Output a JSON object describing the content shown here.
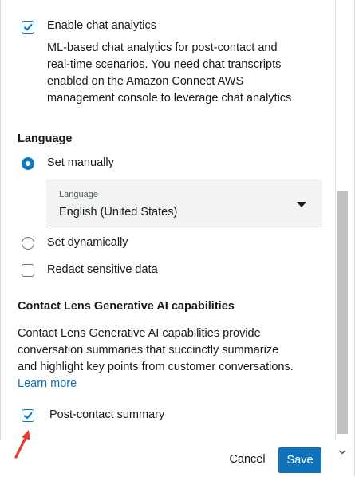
{
  "chat_analytics": {
    "label": "Enable chat analytics",
    "checked": true,
    "description_lines": [
      "ML-based chat analytics for post-contact and",
      "real-time scenarios. You need chat transcripts",
      "enabled on the Amazon Connect AWS",
      "management console to leverage chat analytics"
    ]
  },
  "language": {
    "heading": "Language",
    "set_manually_label": "Set manually",
    "set_manually_selected": true,
    "select_label": "Language",
    "select_value": "English (United States)",
    "set_dynamically_label": "Set dynamically",
    "redact_label": "Redact sensitive data",
    "redact_checked": false
  },
  "gen_ai": {
    "heading": "Contact Lens Generative AI capabilities",
    "description_lines": [
      "Contact Lens Generative AI capabilities provide",
      "conversation summaries that succinctly summarize",
      "and highlight key points from customer conversations."
    ],
    "learn_more": "Learn more",
    "post_contact_label": "Post-contact summary",
    "post_contact_checked": true
  },
  "footer": {
    "cancel_label": "Cancel",
    "save_label": "Save"
  },
  "colors": {
    "accent": "#0f73bc",
    "annotation_arrow": "#e53935"
  }
}
